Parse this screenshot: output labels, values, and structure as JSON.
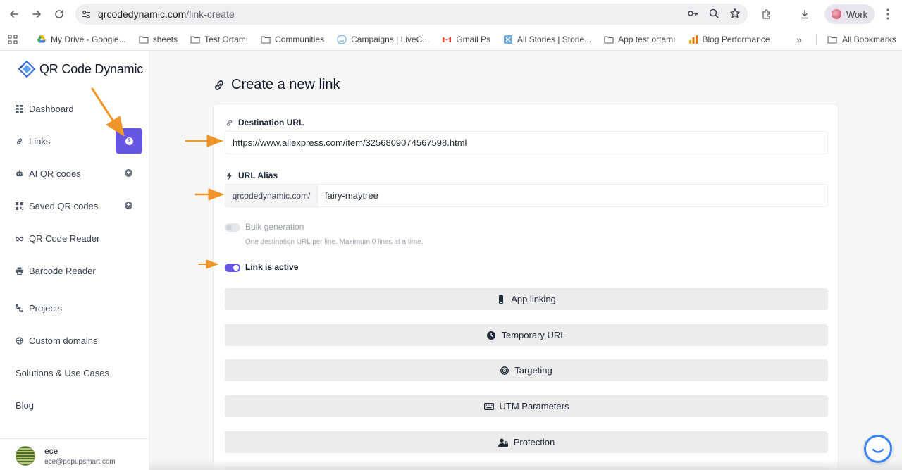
{
  "browser": {
    "url_host": "qrcodedynamic.com",
    "url_path": "/link-create",
    "profile_label": "Work",
    "bookmarks": [
      {
        "label": "My Drive - Google...",
        "icon": "drive-icon"
      },
      {
        "label": "sheets",
        "icon": "folder-icon"
      },
      {
        "label": "Test Ortamı",
        "icon": "folder-icon"
      },
      {
        "label": "Communities",
        "icon": "folder-icon"
      },
      {
        "label": "Campaigns | LiveC...",
        "icon": "livechat-icon"
      },
      {
        "label": "Gmail Ps",
        "icon": "gmail-icon"
      },
      {
        "label": "All Stories | Storie...",
        "icon": "stories-icon"
      },
      {
        "label": "App test ortamı",
        "icon": "folder-icon"
      },
      {
        "label": "Blog Performance",
        "icon": "analytics-icon"
      }
    ],
    "all_bookmarks_label": "All Bookmarks"
  },
  "sidebar": {
    "logo_text": "QR Code Dynamic",
    "items": [
      {
        "label": "Dashboard",
        "icon": "grid-icon"
      },
      {
        "label": "Links",
        "icon": "link-icon"
      },
      {
        "label": "AI QR codes",
        "icon": "robot-icon"
      },
      {
        "label": "Saved QR codes",
        "icon": "qr-icon"
      },
      {
        "label": "QR Code Reader",
        "icon": "glasses-icon"
      },
      {
        "label": "Barcode Reader",
        "icon": "printer-icon"
      },
      {
        "label": "Projects",
        "icon": "sitemap-icon"
      },
      {
        "label": "Custom domains",
        "icon": "globe-icon"
      },
      {
        "label": "Solutions & Use Cases",
        "icon": ""
      },
      {
        "label": "Blog",
        "icon": ""
      }
    ],
    "user": {
      "name": "ece",
      "email": "ece@popupsmart.com"
    }
  },
  "main": {
    "title": "Create a new link",
    "destination_label": "Destination URL",
    "destination_value": "https://www.aliexpress.com/item/3256809074567598.html",
    "alias_label": "URL Alias",
    "alias_prefix": "qrcodedynamic.com/",
    "alias_value": "fairy-maytree",
    "bulk_label": "Bulk generation",
    "bulk_help": "One destination URL per line. Maximum 0 lines at a time.",
    "bulk_enabled": false,
    "active_label": "Link is active",
    "active_enabled": true,
    "sections": [
      {
        "label": "App linking",
        "icon": "mobile-icon"
      },
      {
        "label": "Temporary URL",
        "icon": "clock-icon"
      },
      {
        "label": "Targeting",
        "icon": "target-icon"
      },
      {
        "label": "UTM Parameters",
        "icon": "keyboard-icon"
      },
      {
        "label": "Protection",
        "icon": "user-lock-icon"
      }
    ]
  },
  "colors": {
    "accent": "#6556e6",
    "annotation_arrow": "#f0952a",
    "section_bg": "#ececed"
  }
}
